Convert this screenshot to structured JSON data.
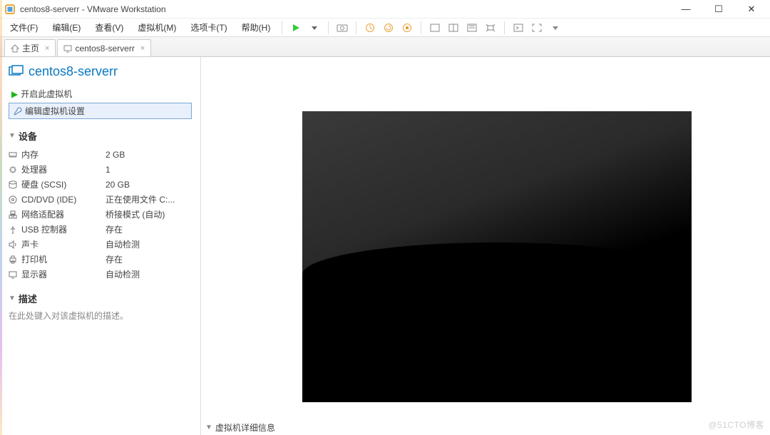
{
  "titlebar": {
    "title": "centos8-serverr - VMware Workstation"
  },
  "menu": {
    "file": "文件(F)",
    "edit": "编辑(E)",
    "view": "查看(V)",
    "vm": "虚拟机(M)",
    "tabs_": "选项卡(T)",
    "help": "帮助(H)"
  },
  "tabs": {
    "home": "主页",
    "vm": "centos8-serverr"
  },
  "vm": {
    "title": "centos8-serverr",
    "run_action": "开启此虚拟机",
    "edit_action": "编辑虚拟机设置"
  },
  "sections": {
    "devices": "设备",
    "description": "描述",
    "details": "虚拟机详细信息"
  },
  "devices": {
    "memory": {
      "name": "内存",
      "value": "2 GB"
    },
    "cpu": {
      "name": "处理器",
      "value": "1"
    },
    "disk": {
      "name": "硬盘 (SCSI)",
      "value": "20 GB"
    },
    "cd": {
      "name": "CD/DVD (IDE)",
      "value": "正在使用文件 C:..."
    },
    "net": {
      "name": "网络适配器",
      "value": "桥接模式 (自动)"
    },
    "usb": {
      "name": "USB 控制器",
      "value": "存在"
    },
    "sound": {
      "name": "声卡",
      "value": "自动检测"
    },
    "printer": {
      "name": "打印机",
      "value": "存在"
    },
    "display": {
      "name": "显示器",
      "value": "自动检测"
    }
  },
  "description_placeholder": "在此处键入对该虚拟机的描述。",
  "watermark": "@51CTO博客"
}
